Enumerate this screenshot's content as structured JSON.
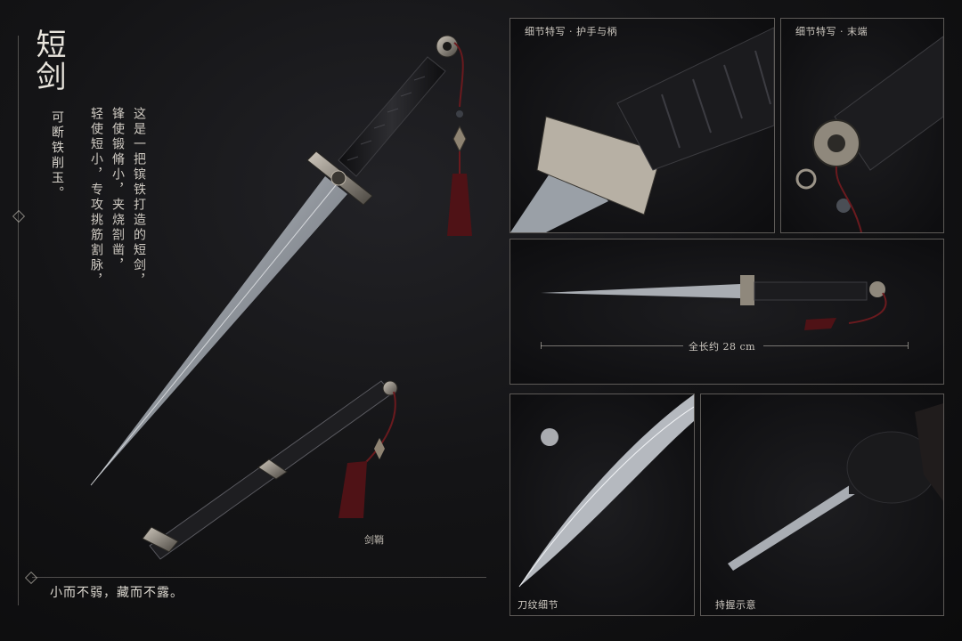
{
  "title": "短剑",
  "motto_vertical": "可断铁削玉。",
  "description_lines": [
    "这是一把镔铁打造的短剑，",
    "锋使锻脩小，夹烧劄凿，",
    "轻使短小，专攻挑筋割脉，"
  ],
  "bottom_motto": "小而不弱，藏而不露。",
  "scabbard_label": "剑鞘",
  "panels": {
    "guard_grip": "细节特写 · 护手与柄",
    "pommel": "细节特写 · 末端",
    "full_view_measure": "全长约 28 cm",
    "blade_pattern": "刀纹细节",
    "grip_demo": "持握示意"
  },
  "colors": {
    "background": "#121214",
    "blade": "#b8bcc2",
    "grip": "#1c1c1e",
    "tassel": "#5a1418",
    "frame": "#8f8a80"
  }
}
